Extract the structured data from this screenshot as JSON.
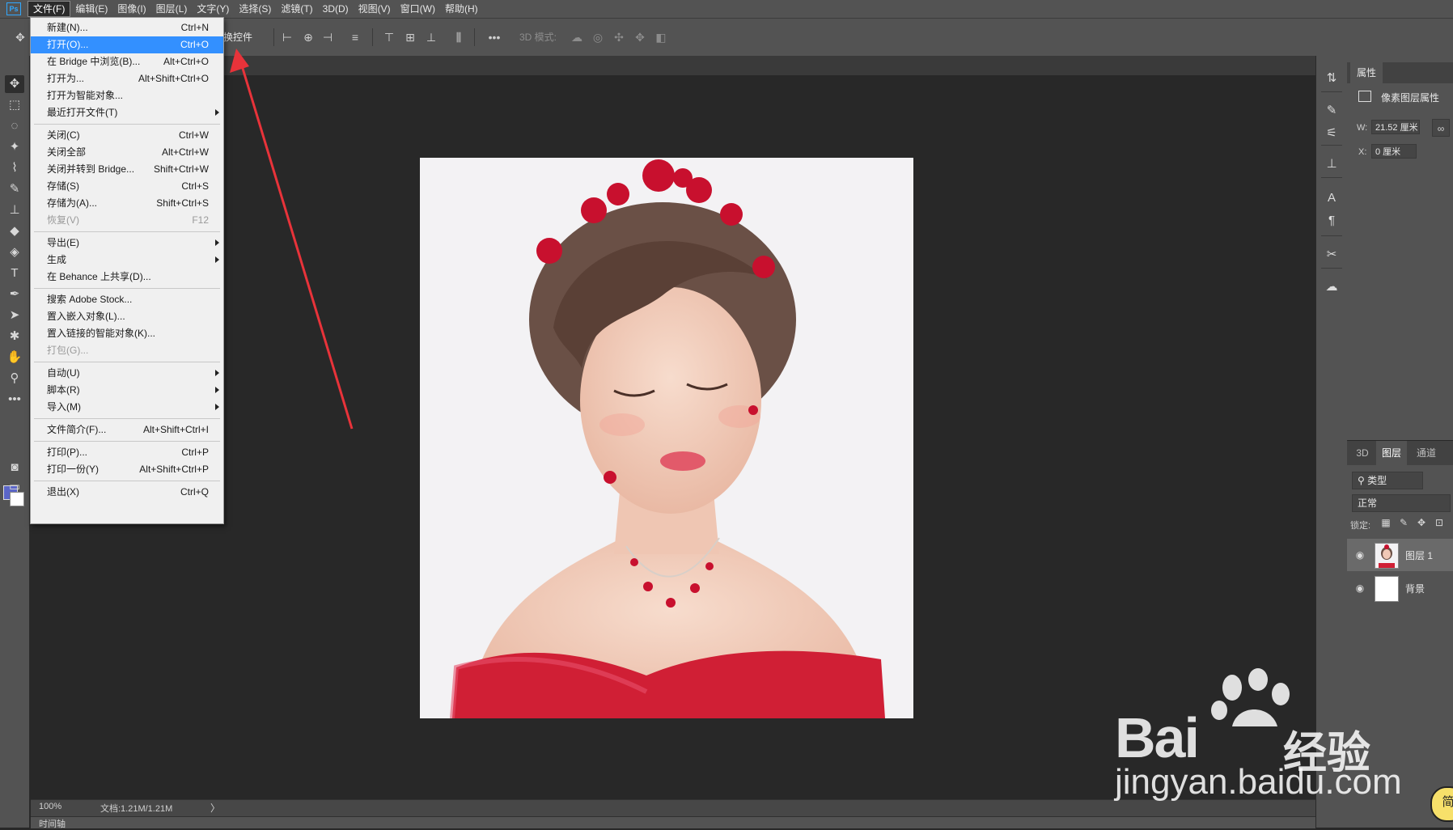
{
  "app": {
    "logo": "Ps"
  },
  "menubar": {
    "items": [
      "文件(F)",
      "编辑(E)",
      "图像(I)",
      "图层(L)",
      "文字(Y)",
      "选择(S)",
      "滤镜(T)",
      "3D(D)",
      "视图(V)",
      "窗口(W)",
      "帮助(H)"
    ],
    "active_index": 0
  },
  "optionsbar": {
    "transform_controls_label": "换控件",
    "mode_3d_label": "3D 模式:"
  },
  "file_menu": {
    "groups": [
      [
        {
          "label": "新建(N)...",
          "shortcut": "Ctrl+N"
        },
        {
          "label": "打开(O)...",
          "shortcut": "Ctrl+O",
          "highlighted": true
        },
        {
          "label": "在 Bridge 中浏览(B)...",
          "shortcut": "Alt+Ctrl+O"
        },
        {
          "label": "打开为...",
          "shortcut": "Alt+Shift+Ctrl+O"
        },
        {
          "label": "打开为智能对象...",
          "shortcut": ""
        },
        {
          "label": "最近打开文件(T)",
          "shortcut": "",
          "submenu": true
        }
      ],
      [
        {
          "label": "关闭(C)",
          "shortcut": "Ctrl+W"
        },
        {
          "label": "关闭全部",
          "shortcut": "Alt+Ctrl+W"
        },
        {
          "label": "关闭并转到 Bridge...",
          "shortcut": "Shift+Ctrl+W"
        },
        {
          "label": "存储(S)",
          "shortcut": "Ctrl+S"
        },
        {
          "label": "存储为(A)...",
          "shortcut": "Shift+Ctrl+S"
        },
        {
          "label": "恢复(V)",
          "shortcut": "F12",
          "disabled": true
        }
      ],
      [
        {
          "label": "导出(E)",
          "shortcut": "",
          "submenu": true
        },
        {
          "label": "生成",
          "shortcut": "",
          "submenu": true
        },
        {
          "label": "在 Behance 上共享(D)...",
          "shortcut": ""
        }
      ],
      [
        {
          "label": "搜索 Adobe Stock...",
          "shortcut": ""
        },
        {
          "label": "置入嵌入对象(L)...",
          "shortcut": ""
        },
        {
          "label": "置入链接的智能对象(K)...",
          "shortcut": ""
        },
        {
          "label": "打包(G)...",
          "shortcut": "",
          "disabled": true
        }
      ],
      [
        {
          "label": "自动(U)",
          "shortcut": "",
          "submenu": true
        },
        {
          "label": "脚本(R)",
          "shortcut": "",
          "submenu": true
        },
        {
          "label": "导入(M)",
          "shortcut": "",
          "submenu": true
        }
      ],
      [
        {
          "label": "文件简介(F)...",
          "shortcut": "Alt+Shift+Ctrl+I"
        }
      ],
      [
        {
          "label": "打印(P)...",
          "shortcut": "Ctrl+P"
        },
        {
          "label": "打印一份(Y)",
          "shortcut": "Alt+Shift+Ctrl+P"
        }
      ],
      [
        {
          "label": "退出(X)",
          "shortcut": "Ctrl+Q"
        }
      ]
    ]
  },
  "status": {
    "zoom": "100%",
    "doc_info": "文档:1.21M/1.21M",
    "arrow": "〉"
  },
  "timeline": {
    "label": "时间轴"
  },
  "properties": {
    "tab": "属性",
    "title": "像素图层属性",
    "w_label": "W:",
    "w_value": "21.52 厘米",
    "x_label": "X:",
    "x_value": "0 厘米"
  },
  "layers_panel": {
    "tabs": [
      "3D",
      "图层",
      "通道"
    ],
    "active_tab": 1,
    "filter_value": "类型",
    "blend_mode": "正常",
    "lock_label": "锁定:",
    "layers": [
      {
        "name": "图层 1",
        "selected": true
      },
      {
        "name": "背景",
        "selected": false
      }
    ]
  },
  "watermark": {
    "brand": "Bai",
    "brand_cn": "经验",
    "url": "jingyan.baidu.com"
  },
  "corner_badge": "简",
  "colors": {
    "accent": "#3390ff",
    "foreground_swatch": "#5b66c8",
    "arrow": "#e8333a"
  }
}
